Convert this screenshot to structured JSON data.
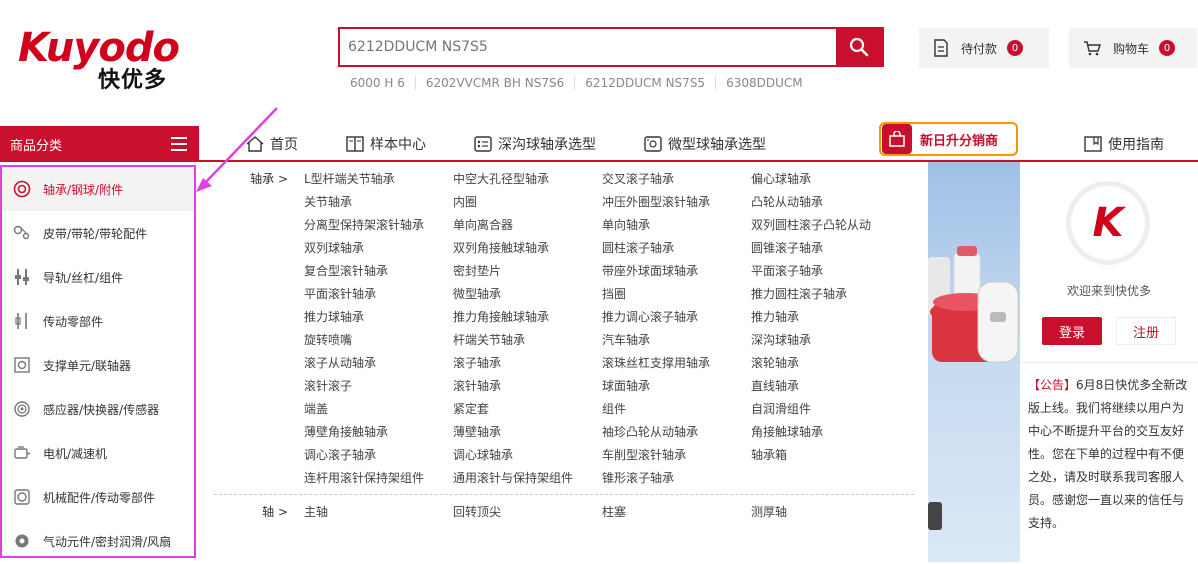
{
  "header": {
    "logo_text": "Kuyodo",
    "logo_cn": "快优多",
    "search_placeholder": "6212DDUCM NS7S5",
    "hot_words": [
      "6000 H 6",
      "6202VVCMR BH NS7S6",
      "6212DDUCM NS7S5",
      "6308DDUCM"
    ],
    "pending_pay": {
      "label": "待付款",
      "count": "0"
    },
    "cart": {
      "label": "购物车",
      "count": "0"
    }
  },
  "nav": {
    "category_title": "商品分类",
    "items": [
      {
        "label": "首页",
        "icon": "home-icon"
      },
      {
        "label": "样本中心",
        "icon": "book-icon"
      },
      {
        "label": "深沟球轴承选型",
        "icon": "list-icon"
      },
      {
        "label": "微型球轴承选型",
        "icon": "image-icon"
      }
    ],
    "promo_label": "新日升分销商",
    "guide_label": "使用指南"
  },
  "sidebar": {
    "items": [
      {
        "label": "轴承/钢球/附件",
        "icon": "bearing-icon",
        "active": true
      },
      {
        "label": "皮带/带轮/带轮配件",
        "icon": "belt-icon"
      },
      {
        "label": "导轨/丝杠/组件",
        "icon": "rail-icon"
      },
      {
        "label": "传动零部件",
        "icon": "transmission-icon"
      },
      {
        "label": "支撑单元/联轴器",
        "icon": "support-unit-icon"
      },
      {
        "label": "感应器/快换器/传感器",
        "icon": "sensor-icon"
      },
      {
        "label": "电机/减速机",
        "icon": "motor-icon"
      },
      {
        "label": "机械配件/传动零部件",
        "icon": "mechanical-parts-icon"
      },
      {
        "label": "气动元件/密封润滑/风扇",
        "icon": "pneumatic-icon"
      }
    ]
  },
  "submenu": {
    "groups": [
      {
        "label": "轴承 >",
        "columns": [
          [
            "L型杆端关节轴承",
            "关节轴承",
            "分离型保持架滚针轴承",
            "双列球轴承",
            "复合型滚针轴承",
            "平面滚针轴承",
            "推力球轴承",
            "旋转喷嘴",
            "滚子从动轴承",
            "滚针滚子",
            "端盖",
            "薄壁角接触轴承",
            "调心滚子轴承",
            "连杆用滚针保持架组件"
          ],
          [
            "中空大孔径型轴承",
            "内圈",
            "单向离合器",
            "双列角接触球轴承",
            "密封垫片",
            "微型轴承",
            "推力角接触球轴承",
            "杆端关节轴承",
            "滚子轴承",
            "滚针轴承",
            "紧定套",
            "薄壁轴承",
            "调心球轴承",
            "通用滚针与保持架组件"
          ],
          [
            "交叉滚子轴承",
            "冲压外圈型滚针轴承",
            "单向轴承",
            "圆柱滚子轴承",
            "带座外球面球轴承",
            "挡圈",
            "推力调心滚子轴承",
            "汽车轴承",
            "滚珠丝杠支撑用轴承",
            "球面轴承",
            "组件",
            "袖珍凸轮从动轴承",
            "车削型滚针轴承",
            "锥形滚子轴承"
          ],
          [
            "偏心球轴承",
            "凸轮从动轴承",
            "双列圆柱滚子凸轮从动",
            "圆锥滚子轴承",
            "平面滚子轴承",
            "推力圆柱滚子轴承",
            "推力轴承",
            "深沟球轴承",
            "滚轮轴承",
            "直线轴承",
            "自润滑组件",
            "角接触球轴承",
            "轴承箱"
          ]
        ]
      },
      {
        "label": "轴 >",
        "columns": [
          [
            "主轴"
          ],
          [
            "回转顶尖"
          ],
          [
            "柱塞"
          ],
          [
            "测厚轴"
          ]
        ]
      }
    ]
  },
  "user_panel": {
    "avatar_letter": "K",
    "welcome": "欢迎来到快优多",
    "login_label": "登录",
    "register_label": "注册",
    "notice_tag": "【公告】",
    "notice_text": "6月8日快优多全新改版上线。我们将继续以用户为中心不断提升平台的交互友好性。您在下单的过程中有不便之处，请及时联系我司客服人员。感谢您一直以来的信任与支持。"
  },
  "colors": {
    "brand_red": "#c8102e",
    "highlight_magenta": "#e040e0",
    "promo_orange": "#f39800"
  }
}
